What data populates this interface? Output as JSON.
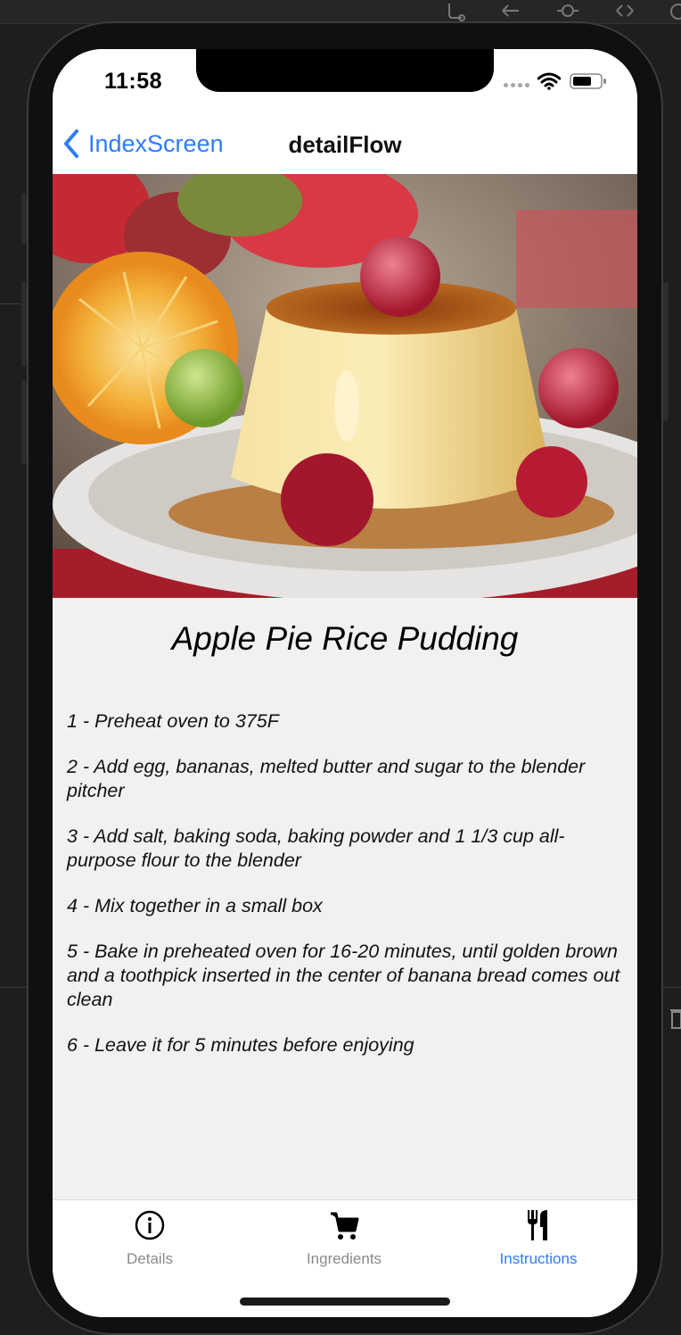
{
  "status_bar": {
    "time": "11:58"
  },
  "nav": {
    "back_label": "IndexScreen",
    "title": "detailFlow"
  },
  "hero": {
    "image": "flan-pudding-with-raspberries-and-orange"
  },
  "recipe": {
    "title": "Apple Pie Rice Pudding",
    "steps": [
      "1 - Preheat oven to 375F",
      "2 - Add egg, bananas, melted butter and sugar to the blender pitcher",
      "3 - Add salt, baking soda, baking powder and 1 1/3 cup all-purpose flour to the blender",
      "4 - Mix together in a small box",
      "5 - Bake in preheated oven for 16-20 minutes, until golden brown and a toothpick inserted in the center of banana bread comes out clean",
      "6 - Leave it for 5 minutes before enjoying"
    ]
  },
  "tabs": [
    {
      "label": "Details",
      "icon": "info-circle-icon",
      "active": false
    },
    {
      "label": "Ingredients",
      "icon": "cart-icon",
      "active": false
    },
    {
      "label": "Instructions",
      "icon": "fork-knife-icon",
      "active": true
    }
  ],
  "colors": {
    "accent": "#2e7cf6",
    "inactive_tab": "#8a8a8a",
    "content_background": "#f1f1f1"
  }
}
